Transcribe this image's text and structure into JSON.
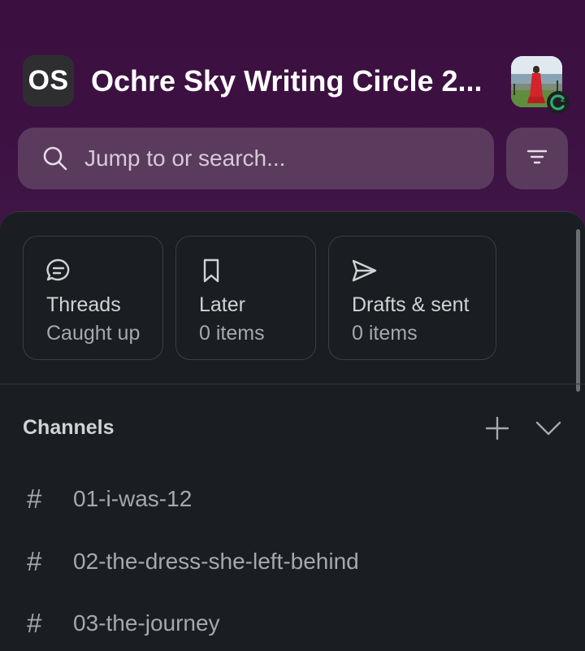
{
  "workspace": {
    "initials": "OS",
    "name": "Ochre Sky Writing Circle 2..."
  },
  "user": {
    "avatar_icon": "user-avatar",
    "presence_icon": "snooze-icon"
  },
  "search": {
    "placeholder": "Jump to or search...",
    "icon": "search-icon"
  },
  "filter": {
    "icon": "filter-icon"
  },
  "shortcuts": [
    {
      "title": "Threads",
      "subtitle": "Caught up",
      "icon": "threads-icon"
    },
    {
      "title": "Later",
      "subtitle": "0 items",
      "icon": "bookmark-icon"
    },
    {
      "title": "Drafts & sent",
      "subtitle": "0 items",
      "icon": "send-icon"
    }
  ],
  "channels_section": {
    "title": "Channels",
    "add_icon": "plus-icon",
    "collapse_icon": "chevron-down-icon",
    "items": [
      {
        "name": "01-i-was-12"
      },
      {
        "name": "02-the-dress-she-left-behind"
      },
      {
        "name": "03-the-journey"
      }
    ]
  },
  "colors": {
    "header_bg": "#3c1142",
    "search_bg": "#5a3b5d",
    "panel_bg": "#1a1d21",
    "text_primary": "#d1d2d3",
    "text_secondary": "#a6a8ab"
  }
}
